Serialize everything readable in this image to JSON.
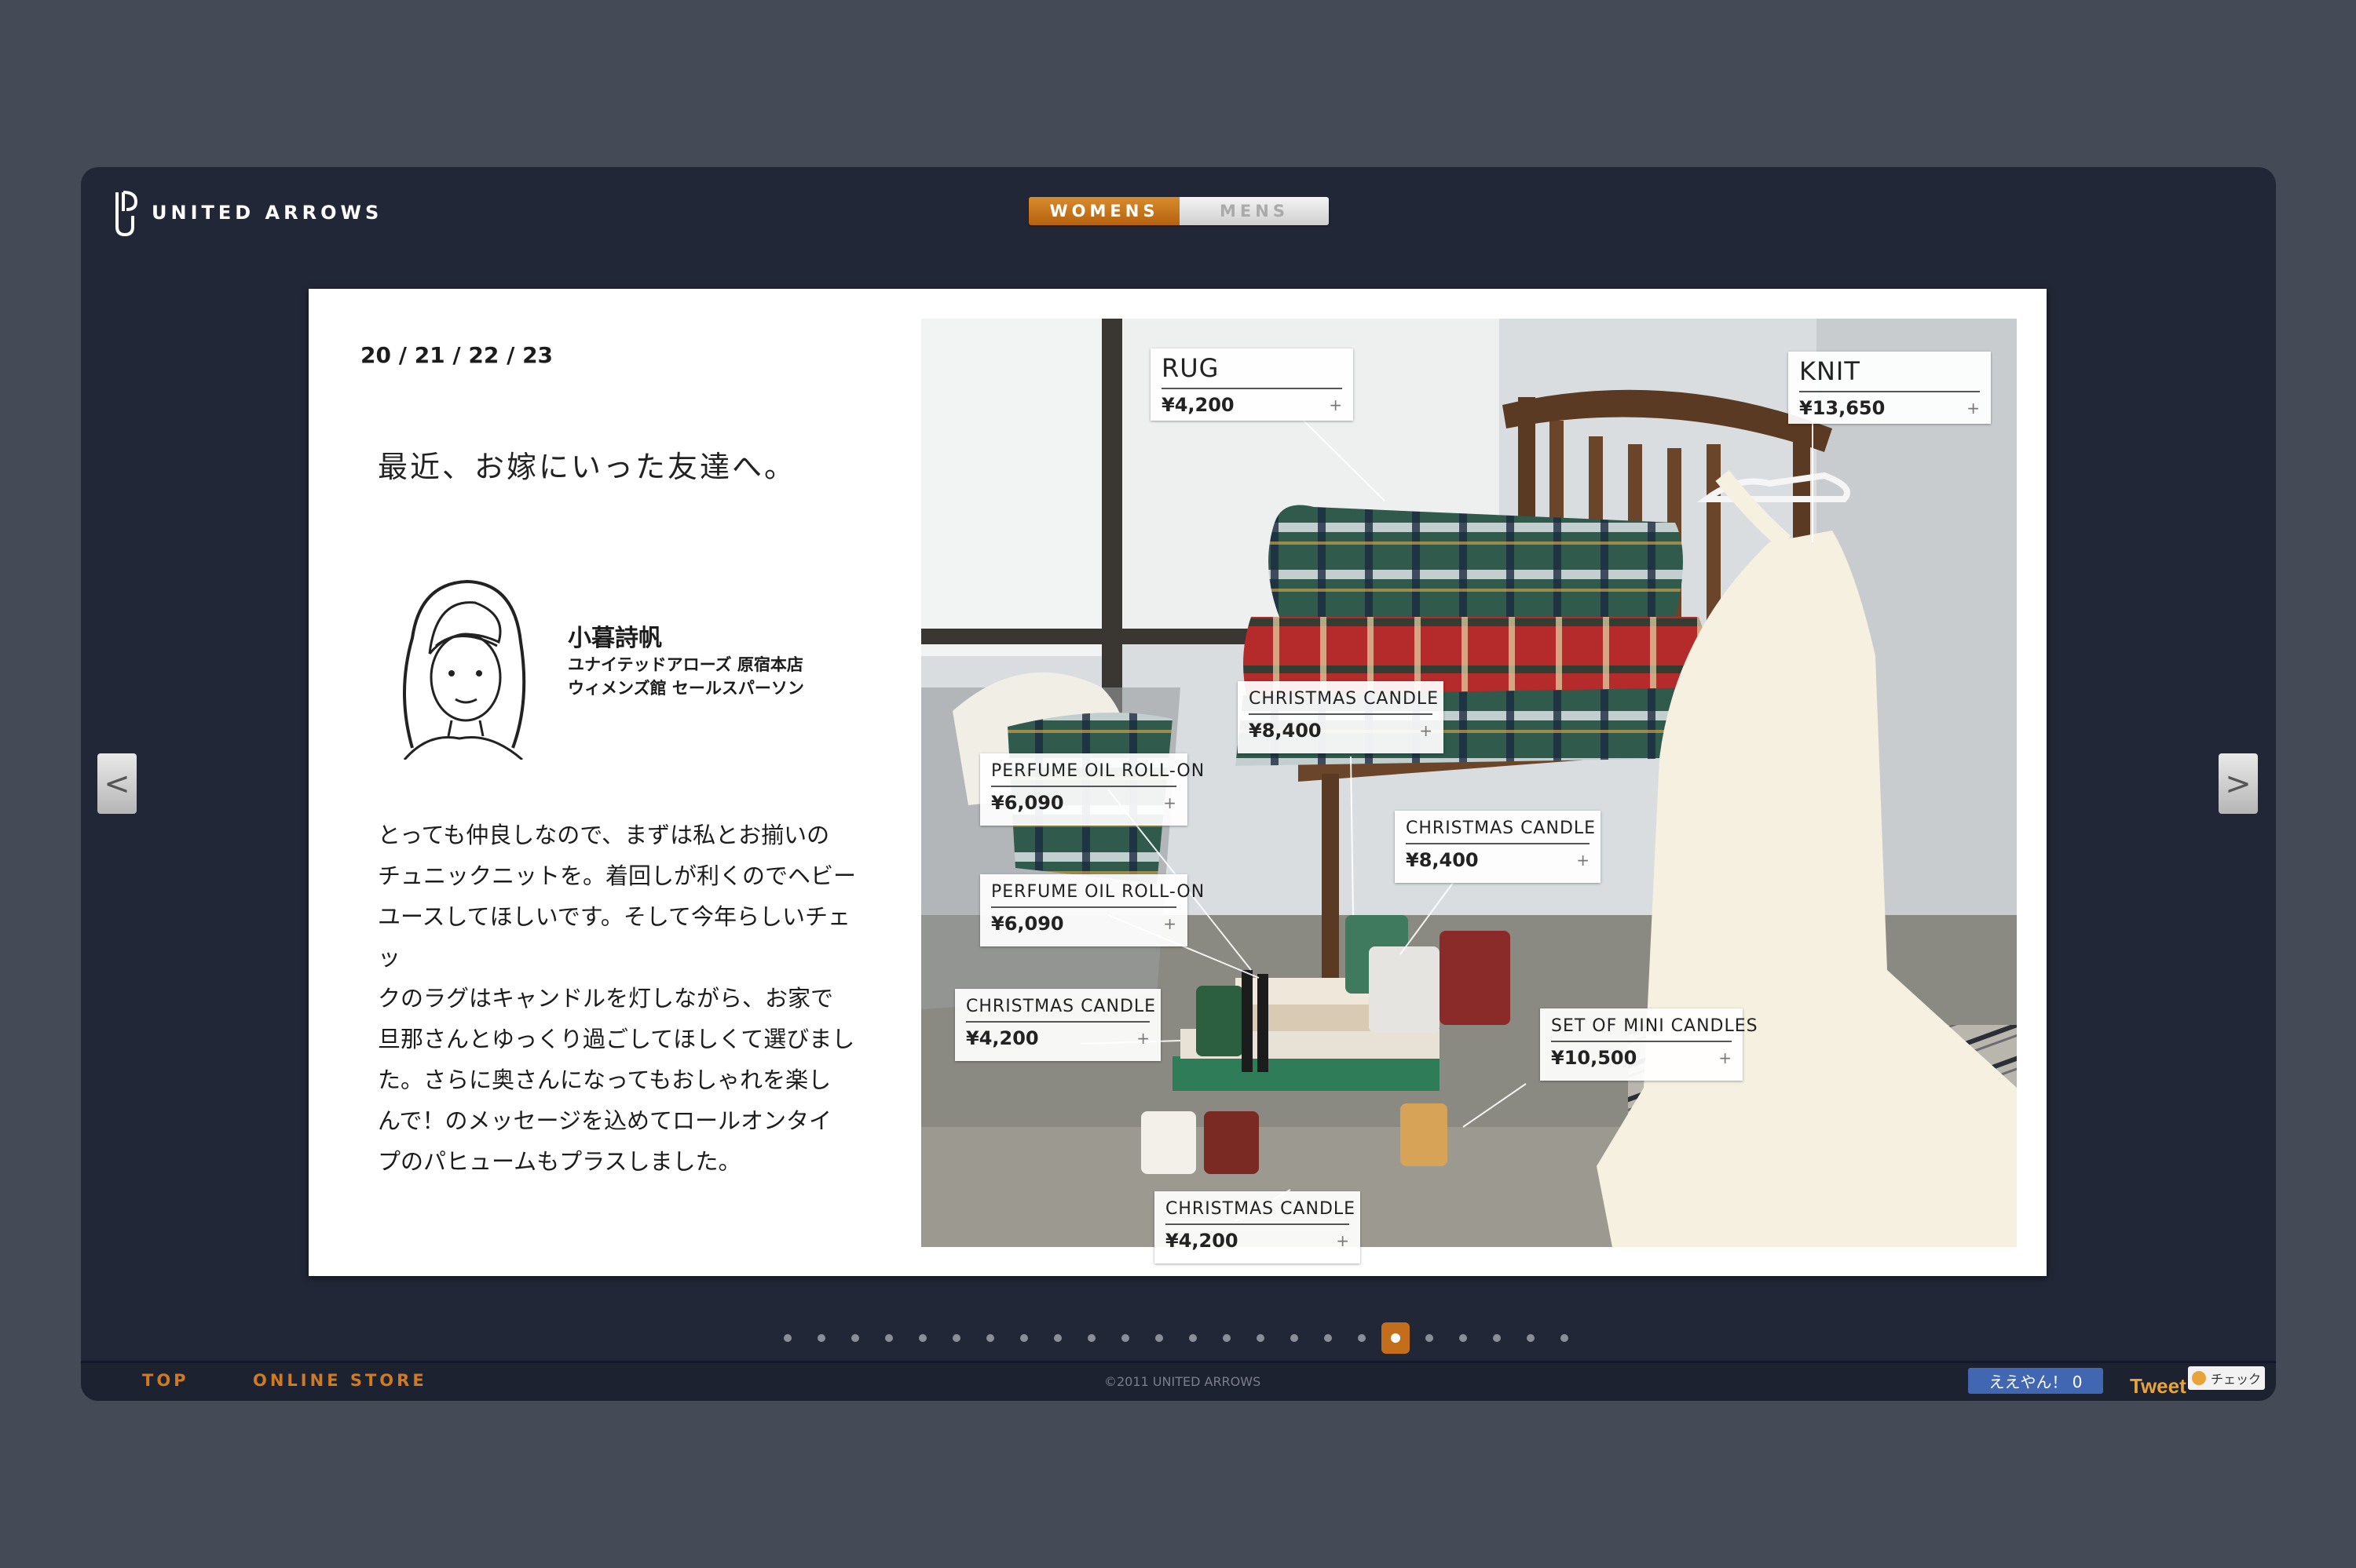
{
  "brand": {
    "name": "UNITED ARROWS"
  },
  "nav": {
    "tabs": [
      {
        "label": "WOMENS",
        "active": true
      },
      {
        "label": "MENS",
        "active": false
      }
    ]
  },
  "article": {
    "date": "20 / 21 / 22 / 23",
    "headline": "最近、お嫁にいった友達へ。",
    "person": {
      "name": "小暮詩帆",
      "role_line1": "ユナイテッドアローズ 原宿本店",
      "role_line2": "ウィメンズ館 セールスパーソン"
    },
    "message_lines": [
      "とっても仲良しなので、まずは私とお揃いの",
      "チュニックニットを。着回しが利くのでヘビー",
      "ユースしてほしいです。そして今年らしいチェッ",
      "クのラグはキャンドルを灯しながら、お家で",
      "旦那さんとゆっくり過ごしてほしくて選びまし",
      "た。さらに奥さんになってもおしゃれを楽し",
      "んで！のメッセージを込めてロールオンタイ",
      "プのパヒュームもプラスしました。"
    ]
  },
  "products": [
    {
      "name": "RUG",
      "price": "¥4,200"
    },
    {
      "name": "KNIT",
      "price": "¥13,650"
    },
    {
      "name": "CHRISTMAS CANDLE",
      "price": "¥8,400"
    },
    {
      "name": "PERFUME OIL ROLL-ON",
      "price": "¥6,090"
    },
    {
      "name": "CHRISTMAS CANDLE",
      "price": "¥8,400"
    },
    {
      "name": "PERFUME OIL ROLL-ON",
      "price": "¥6,090"
    },
    {
      "name": "CHRISTMAS CANDLE",
      "price": "¥4,200"
    },
    {
      "name": "SET OF MINI CANDLES",
      "price": "¥10,500"
    },
    {
      "name": "CHRISTMAS CANDLE",
      "price": "¥4,200"
    }
  ],
  "tag_plus": "+",
  "arrows": {
    "prev": "<",
    "next": ">"
  },
  "pager": {
    "total": 24,
    "active_index": 18
  },
  "footer": {
    "top_link": "TOP",
    "store_link": "ONLINE STORE",
    "copyright": "©2011 UNITED ARROWS",
    "like_label": "ええやん！ 0",
    "tweet_label": "Tweet",
    "check_label": "チェック"
  },
  "colors": {
    "background": "#454b56",
    "frame": "#222737",
    "accent": "#c26e1a",
    "facebook": "#4267b2"
  }
}
